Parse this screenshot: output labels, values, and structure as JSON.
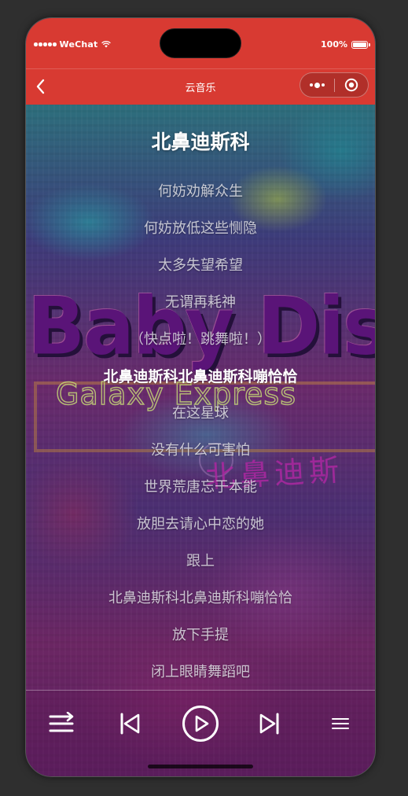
{
  "status_bar": {
    "carrier": "WeChat",
    "battery": "100%"
  },
  "nav": {
    "title": "云音乐",
    "back_icon": "chevron-left-icon",
    "more_icon": "more-dots-icon",
    "close_icon": "target-circle-icon"
  },
  "cover_art": {
    "headline": "Baby Disco",
    "neon_text": "Galaxy Express",
    "chinese_text": "北鼻迪斯"
  },
  "song": {
    "title": "北鼻迪斯科"
  },
  "lyrics": [
    "何妨劝解众生",
    "何妨放低这些恻隐",
    "太多失望希望",
    "无谓再耗神",
    "（快点啦！跳舞啦！）",
    "北鼻迪斯科北鼻迪斯科嘣恰恰",
    "在这星球",
    "没有什么可害怕",
    "世界荒唐忘于本能",
    "放胆去请心中恋的她",
    "跟上",
    "北鼻迪斯科北鼻迪斯科嘣恰恰",
    "放下手提",
    "闭上眼睛舞蹈吧"
  ],
  "active_lyric_index": 5,
  "player": {
    "controls": [
      "shuffle-icon",
      "previous-icon",
      "play-icon",
      "next-icon",
      "playlist-icon"
    ]
  },
  "colors": {
    "header": "#d83a32",
    "lyric_active": "#ffffff",
    "lyric_inactive": "#e6e6eb"
  }
}
